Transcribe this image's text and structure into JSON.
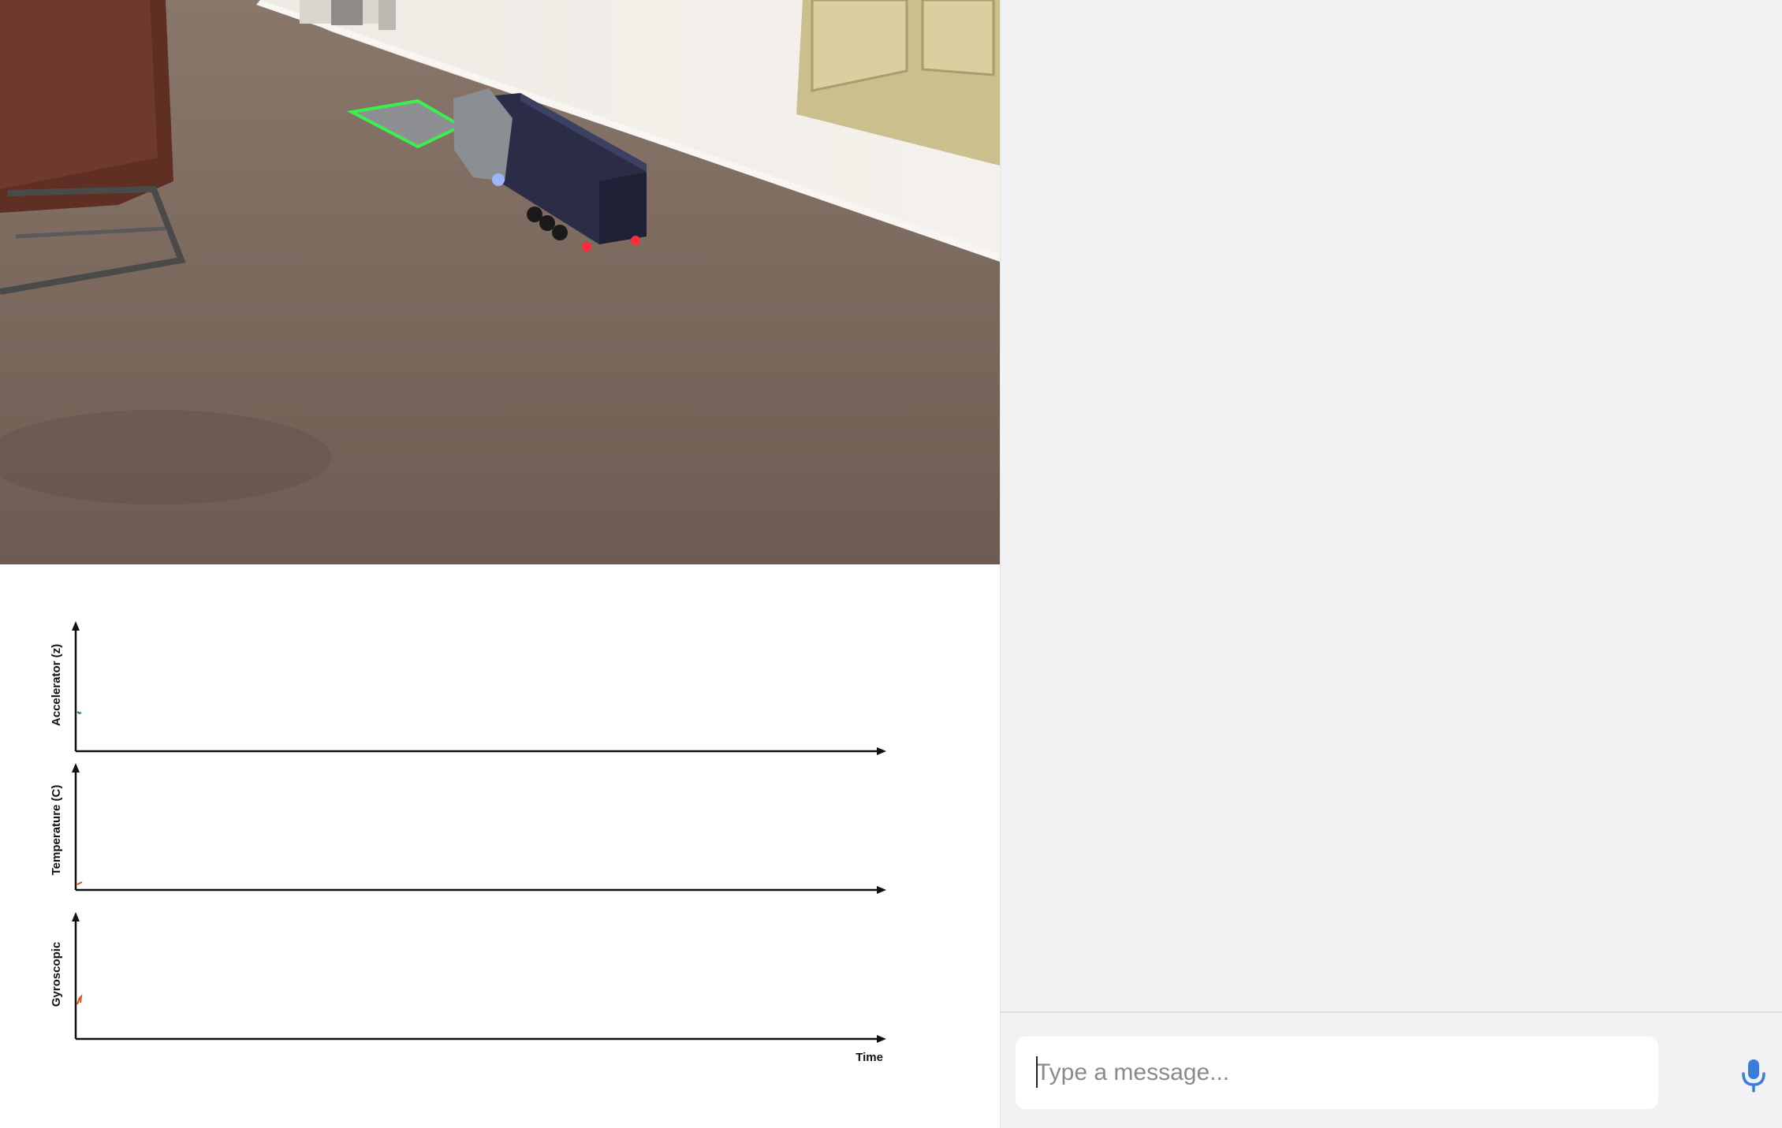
{
  "video": {
    "scene": "camera-feed"
  },
  "charts": {
    "panels": [
      {
        "ylabel": "Accelerator (z)",
        "color": "#2e7d32"
      },
      {
        "ylabel": "Temperature (C)",
        "color": "#e64a19"
      },
      {
        "ylabel": "Gyroscopic",
        "color": "#e64a19"
      }
    ],
    "xlabel": "Time"
  },
  "chart_data": [
    {
      "type": "line",
      "ylabel": "Accelerator (z)",
      "xlabel": "",
      "series": [
        {
          "values": []
        }
      ]
    },
    {
      "type": "line",
      "ylabel": "Temperature (C)",
      "xlabel": "",
      "series": [
        {
          "values": []
        }
      ]
    },
    {
      "type": "line",
      "ylabel": "Gyroscopic",
      "xlabel": "Time",
      "series": [
        {
          "values": []
        }
      ]
    }
  ],
  "chat": {
    "input_placeholder": "Type a message...",
    "input_value": "",
    "mic_icon": "microphone-icon",
    "accent": "#3b7ddd"
  }
}
